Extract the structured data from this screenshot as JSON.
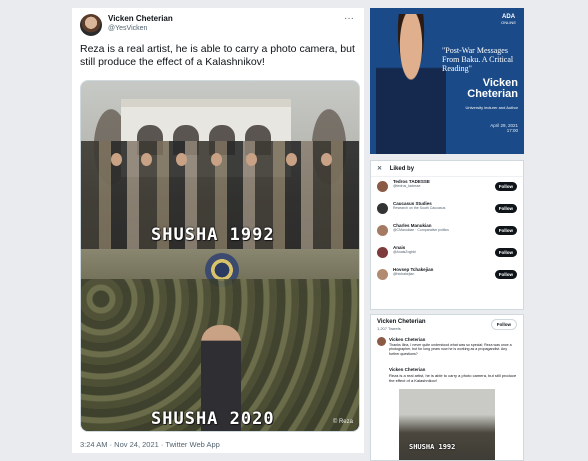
{
  "tweet": {
    "name": "Vicken Cheterian",
    "handle": "@YesVicken",
    "more": "···",
    "text": "Reza is a real artist, he is able to carry a photo camera, but still produce the effect of a Kalashnikov!",
    "caption_top": "SHUSHA 1992",
    "caption_bottom": "SHUSHA 2020",
    "watermark": "© Reza",
    "meta": "3:24 AM · Nov 24, 2021 · Twitter Web App"
  },
  "poster": {
    "logo": "ADA",
    "logo_sub": "ONLINE",
    "title": "\"Post-War Messages From Baku. A Critical Reading\"",
    "name_line1": "Vicken",
    "name_line2": "Cheterian",
    "subtitle": "University lecturer and Author",
    "date": "April 29, 2021",
    "time": "17:00"
  },
  "liked_by": {
    "close": "✕",
    "title": "Liked by",
    "rows": [
      {
        "name": "Tedros TADESSE",
        "sub": "@tedros_tadesse",
        "button": "Follow"
      },
      {
        "name": "Caucasus Studies",
        "sub": "Research on the South Caucasus",
        "button": "Follow"
      },
      {
        "name": "Charles Manukian",
        "sub": "@CManukian · Comparative politics",
        "button": "Follow"
      },
      {
        "name": "Anais",
        "sub": "@AnaisZoghbi",
        "button": "Follow"
      },
      {
        "name": "Hovsep Tchakejian",
        "sub": "@htchakejian",
        "button": "Follow"
      }
    ]
  },
  "profile": {
    "name": "Vicken Cheterian",
    "count": "1,207 Tweets",
    "follow": "Follow",
    "reply_name": "Vicken Cheterian",
    "reply_text": "Thanks Ilina, I never quite understood what was so special; Reza was once a photographer, but for long years now he is working as a propagandist. Any further questions?",
    "quote_name": "Vicken Cheterian",
    "quote_text": "Reza is a real artist, he is able to carry a photo camera, but still produce the effect of a Kalashnikov!",
    "quote_caption": "SHUSHA 1992"
  },
  "colors": {
    "poster_bg": "#1a4a88",
    "follow_btn": "#0f1419"
  }
}
